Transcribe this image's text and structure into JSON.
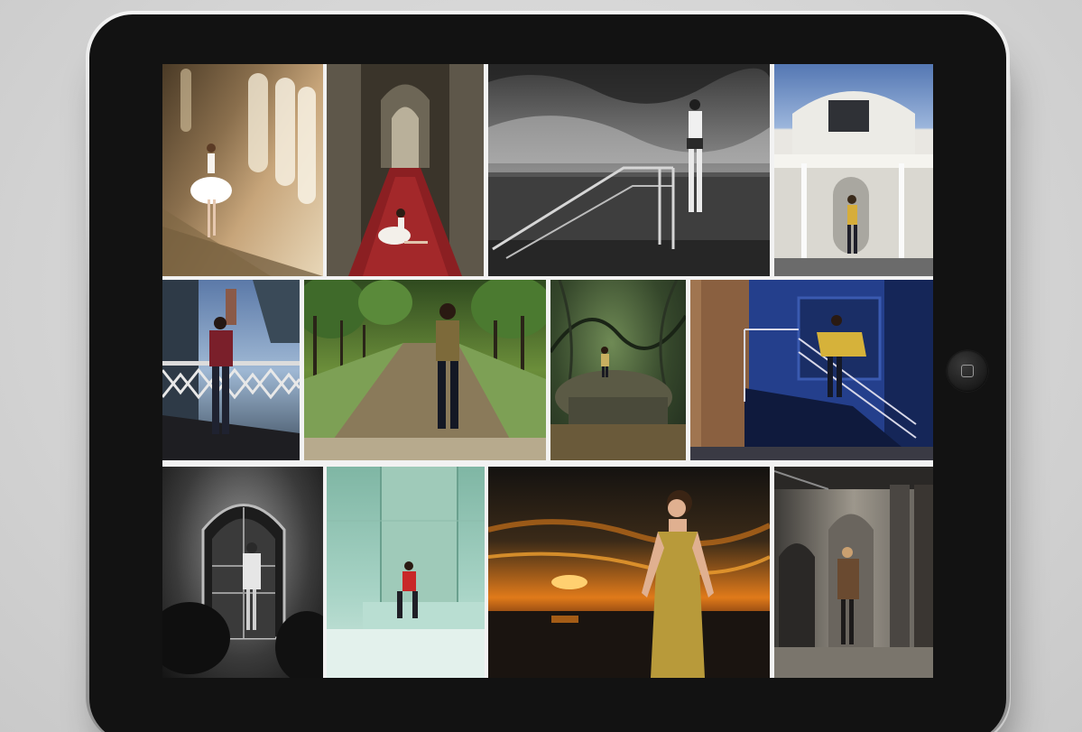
{
  "device": {
    "type": "tablet",
    "home_button_icon": "home-square-icon"
  },
  "gallery": {
    "photos": [
      {
        "id": "p1",
        "subject": "ballerina-on-castle-staircase",
        "palette": [
          "#8a6f4d",
          "#c7a57a",
          "#e8d7b8"
        ]
      },
      {
        "id": "p2",
        "subject": "ballerina-on-red-staircase",
        "palette": [
          "#4b4436",
          "#8b2a2a",
          "#c9c2b0"
        ]
      },
      {
        "id": "p3",
        "subject": "bw-woman-on-railing-by-sea",
        "palette": [
          "#2b2b2b",
          "#8c8c8c",
          "#d0d0d0"
        ]
      },
      {
        "id": "p4",
        "subject": "woman-at-art-deco-house",
        "palette": [
          "#3d5a8a",
          "#e9e7e2",
          "#6b6b6b"
        ]
      },
      {
        "id": "p5",
        "subject": "woman-on-bridge",
        "palette": [
          "#3b4a5a",
          "#8aa0b5",
          "#7a1f2a"
        ]
      },
      {
        "id": "p6",
        "subject": "woman-in-tree-avenue",
        "palette": [
          "#3d5a28",
          "#7da055",
          "#8a7a5a"
        ]
      },
      {
        "id": "p7",
        "subject": "woman-in-forest-glade",
        "palette": [
          "#1f2a1d",
          "#4f6a3d",
          "#c8b060"
        ]
      },
      {
        "id": "p8",
        "subject": "woman-on-blue-stairs",
        "palette": [
          "#1f3a7a",
          "#8a6040",
          "#d6b23a"
        ]
      },
      {
        "id": "p9",
        "subject": "bw-woman-at-gothic-window",
        "palette": [
          "#1c1c1c",
          "#5a5a5a",
          "#d8d8d8"
        ]
      },
      {
        "id": "p10",
        "subject": "woman-in-red-mint-room",
        "palette": [
          "#8fc4b3",
          "#b9ded2",
          "#c82828"
        ]
      },
      {
        "id": "p11",
        "subject": "woman-gold-dress-sunset",
        "palette": [
          "#1d1a14",
          "#e07a1a",
          "#b89a3a"
        ]
      },
      {
        "id": "p12",
        "subject": "woman-in-stone-archway",
        "palette": [
          "#5d5a55",
          "#9d978c",
          "#6a4a30"
        ]
      }
    ]
  }
}
